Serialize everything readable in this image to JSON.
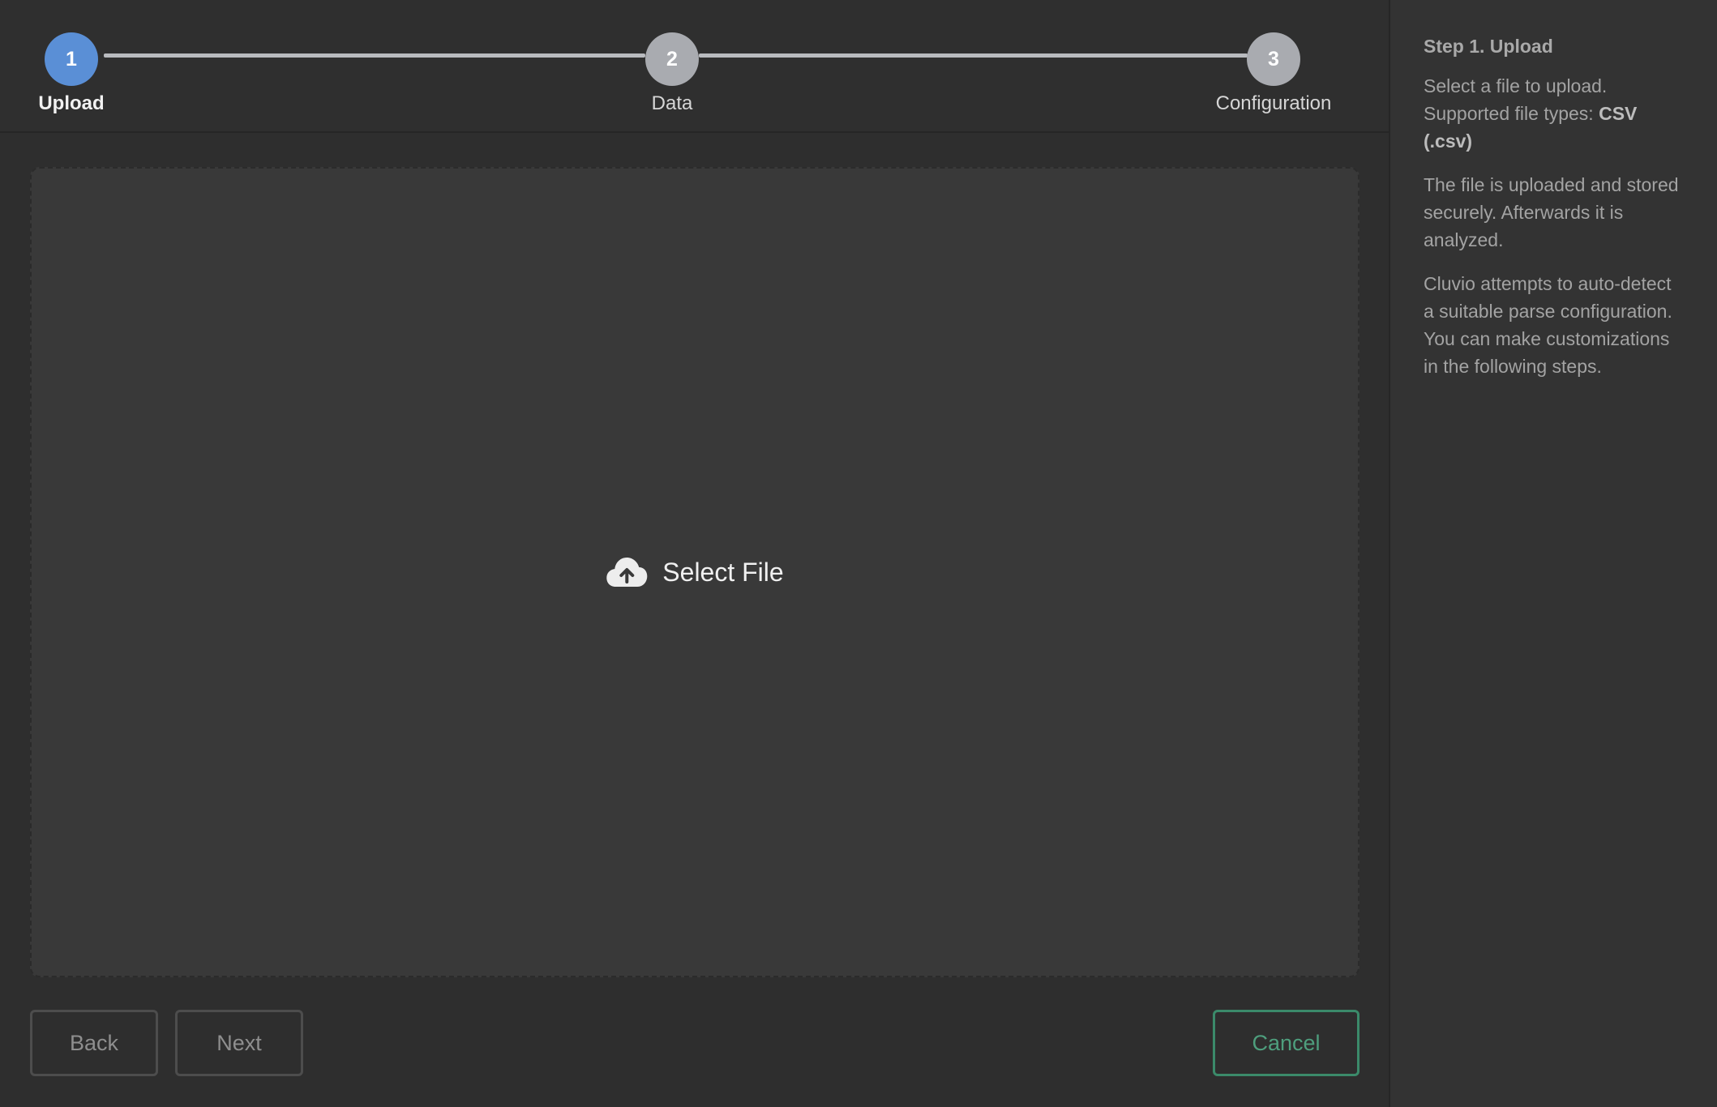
{
  "stepper": {
    "steps": [
      {
        "number": "1",
        "label": "Upload",
        "active": true
      },
      {
        "number": "2",
        "label": "Data",
        "active": false
      },
      {
        "number": "3",
        "label": "Configuration",
        "active": false
      }
    ]
  },
  "dropzone": {
    "select_label": "Select File",
    "icon": "cloud-upload-icon"
  },
  "footer": {
    "back_label": "Back",
    "next_label": "Next",
    "cancel_label": "Cancel"
  },
  "help": {
    "title": "Step 1. Upload",
    "p1_text": "Select a file to upload. Supported file types: ",
    "p1_bold": "CSV (.csv)",
    "p2": "The file is uploaded and stored securely. Afterwards it is analyzed.",
    "p3": "Cluvio attempts to auto-detect a suitable parse configuration. You can make customizations in the following steps."
  },
  "colors": {
    "active_step": "#5a8fd6",
    "inactive_step": "#a9abb0",
    "cancel_accent": "#3b8a6a",
    "background": "#2e2e2e"
  }
}
